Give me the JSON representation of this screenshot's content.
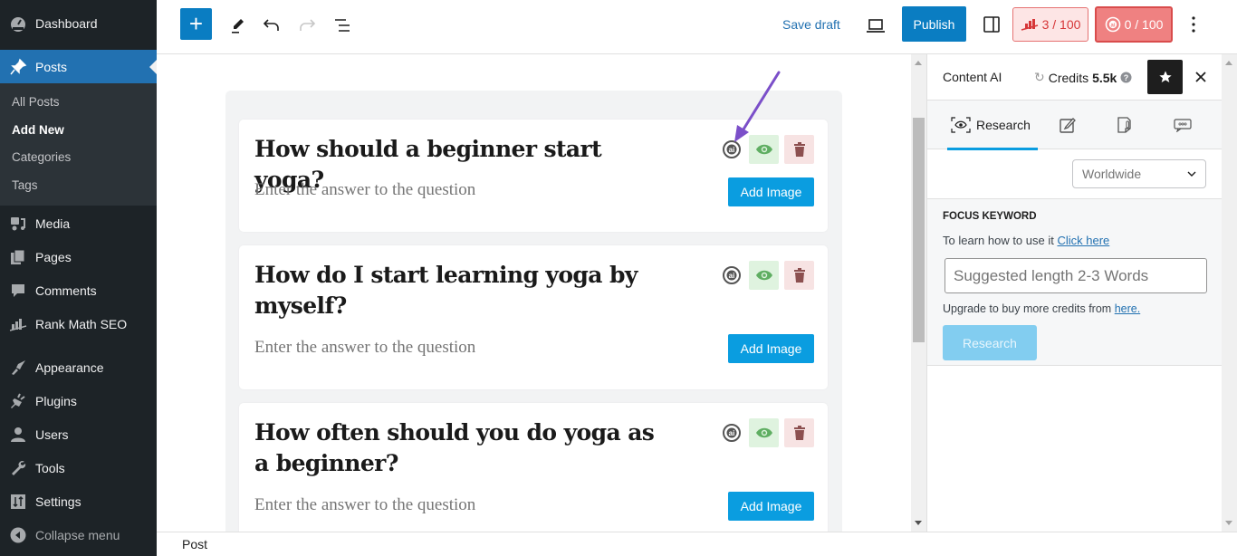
{
  "sidebar": {
    "items": [
      {
        "label": "Dashboard",
        "icon": "dashboard-icon"
      },
      {
        "label": "Posts",
        "icon": "pin-icon",
        "active": true
      },
      {
        "label": "Media",
        "icon": "media-icon"
      },
      {
        "label": "Pages",
        "icon": "pages-icon"
      },
      {
        "label": "Comments",
        "icon": "comments-icon"
      },
      {
        "label": "Rank Math SEO",
        "icon": "rank-math-icon"
      },
      {
        "label": "Appearance",
        "icon": "paintbrush-icon"
      },
      {
        "label": "Plugins",
        "icon": "plugin-icon"
      },
      {
        "label": "Users",
        "icon": "user-icon"
      },
      {
        "label": "Tools",
        "icon": "wrench-icon"
      },
      {
        "label": "Settings",
        "icon": "settings-icon"
      }
    ],
    "submenu": [
      "All Posts",
      "Add New",
      "Categories",
      "Tags"
    ],
    "current_submenu": "Add New",
    "collapse_label": "Collapse menu"
  },
  "toolbar": {
    "add_block": "+",
    "save_draft": "Save draft",
    "publish": "Publish",
    "rank_math_score": "3 / 100",
    "content_ai_score": "0 / 100"
  },
  "faq": {
    "answer_placeholder": "Enter the answer to the question",
    "add_image_label": "Add Image",
    "items": [
      {
        "question": "How should a beginner start yoga?"
      },
      {
        "question": "How do I start learning yoga by myself?"
      },
      {
        "question": "How often should you do yoga as a beginner?"
      }
    ]
  },
  "panel": {
    "title": "Content AI",
    "credits_label": "Credits",
    "credits_value": "5.5k",
    "tabs": [
      {
        "label": "Research",
        "icon": "research-eye-icon",
        "active": true
      },
      {
        "label": "",
        "icon": "write-icon"
      },
      {
        "label": "",
        "icon": "ai-tools-icon"
      },
      {
        "label": "",
        "icon": "chat-icon"
      }
    ],
    "country": "Worldwide",
    "focus_keyword_label": "FOCUS KEYWORD",
    "help_text": "To learn how to use it",
    "help_link": "Click here",
    "keyword_placeholder": "Suggested length 2-3 Words",
    "keyword_value": "",
    "upgrade_text": "Upgrade to buy more credits from",
    "upgrade_link": "here.",
    "research_button": "Research"
  },
  "footer": {
    "breadcrumb": "Post"
  },
  "colors": {
    "wp_blue": "#2271b1",
    "publish_blue": "#0a7dc2",
    "add_image_blue": "#0a9de0",
    "sidebar_bg": "#1d2327",
    "score_red": "#d63638",
    "annotation_arrow": "#7b4fc9"
  }
}
